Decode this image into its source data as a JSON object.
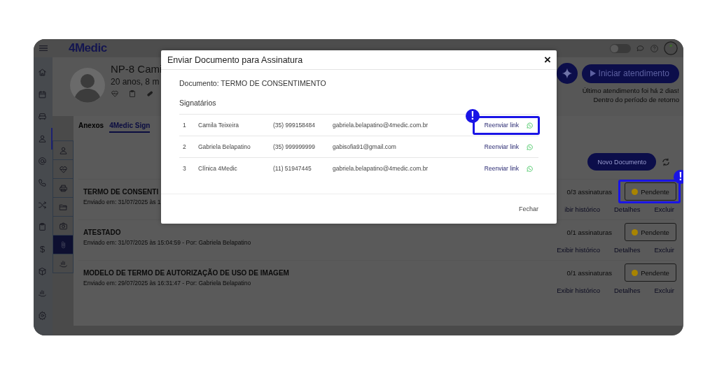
{
  "topbar": {
    "logo": "4Medic",
    "toggle": {
      "on": false
    }
  },
  "rail": [
    {
      "selected": false
    },
    {
      "selected": false
    },
    {
      "selected": false
    },
    {
      "selected": true
    },
    {
      "selected": false
    },
    {
      "selected": false
    },
    {
      "selected": false
    },
    {
      "selected": false
    },
    {
      "selected": false,
      "glyph": "$"
    },
    {
      "selected": false
    },
    {
      "selected": false
    },
    {
      "selected": false
    }
  ],
  "patient": {
    "name": "NP-8 Cami",
    "age": "20 anos, 8 m"
  },
  "header_actions": {
    "start_button": "Iniciar atendimento",
    "last_visit": "Último atendimento foi há 2 dias!",
    "return_note": "Dentro do período de retorno"
  },
  "tabs": [
    {
      "label": "Anexos",
      "selected": false
    },
    {
      "label": "4Medic Sign",
      "selected": true
    }
  ],
  "side_tools": [
    {
      "selected": false
    },
    {
      "selected": false
    },
    {
      "selected": false
    },
    {
      "selected": false
    },
    {
      "selected": false
    },
    {
      "selected": true
    },
    {
      "selected": false
    }
  ],
  "new_document_button": "Novo Documento",
  "documents": [
    {
      "title": "TERMO DE CONSENTI",
      "sent": "Enviado em: 31/07/2025 às 1",
      "signatures": "0/3 assinaturas",
      "status": "Pendente",
      "actions": [
        "ibir histórico",
        "Detalhes",
        "Excluir"
      ],
      "highlighted": true,
      "badge": "!"
    },
    {
      "title": "ATESTADO",
      "sent": "Enviado em: 31/07/2025 às 15:04:59 - Por: Gabriela Belapatino",
      "signatures": "0/1 assinaturas",
      "status": "Pendente",
      "actions": [
        "Exibir histórico",
        "Detalhes",
        "Excluir"
      ],
      "highlighted": false
    },
    {
      "title": "MODELO DE TERMO DE AUTORIZAÇÃO DE USO DE IMAGEM",
      "sent": "Enviado em: 29/07/2025 às 16:31:47 - Por: Gabriela Belapatino",
      "signatures": "0/1 assinaturas",
      "status": "Pendente",
      "actions": [
        "Exibir histórico",
        "Detalhes",
        "Excluir"
      ],
      "highlighted": false
    }
  ],
  "modal": {
    "title": "Enviar Documento para Assinatura",
    "close": "×",
    "document": "Documento: TERMO DE CONSENTIMENTO",
    "signers_heading": "Signatários",
    "signers": [
      {
        "index": "1",
        "name": "Camila Teixeira",
        "phone": "(35) 999158484",
        "email": "gabriela.belapatino@4medic.com.br",
        "action": "Reenviar link",
        "highlighted": true,
        "badge": "!"
      },
      {
        "index": "2",
        "name": "Gabriela Belapatino",
        "phone": "(35) 999999999",
        "email": "gabisofia91@gmail.com",
        "action": "Reenviar link",
        "highlighted": false
      },
      {
        "index": "3",
        "name": "Clínica 4Medic",
        "phone": "(11) 51947445",
        "email": "gabriela.belapatino@4medic.com.br",
        "action": "Reenviar link",
        "highlighted": false
      }
    ],
    "close_button": "Fechar"
  }
}
